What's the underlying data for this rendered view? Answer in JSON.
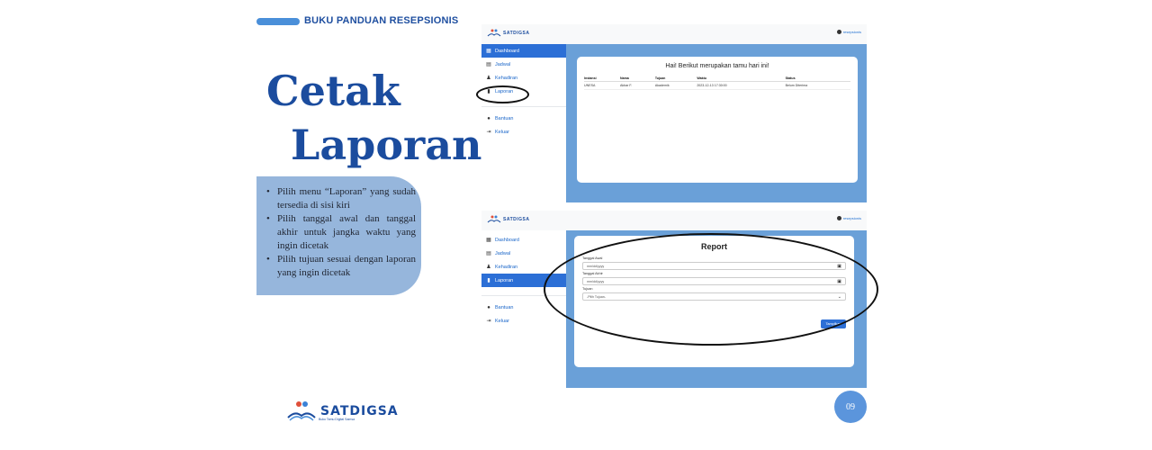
{
  "header": {
    "label": "BUKU PANDUAN RESEPSIONIS"
  },
  "title": {
    "line1": "Cetak",
    "line2": "Laporan"
  },
  "steps": [
    "Pilih menu “Laporan” yang sudah tersedia di sisi kiri",
    "Pilih tanggal awal dan tanggal akhir untuk jangka waktu yang ingin dicetak",
    "Pilih tujuan sesuai dengan laporan yang ingin dicetak"
  ],
  "brand": {
    "name": "SATDIGSA",
    "tagline": "Buku Tamu Digital Samsa"
  },
  "page_number": "09",
  "app": {
    "logo": "SATDIGSA",
    "user": "resepsionis",
    "nav": [
      "Dashboard",
      "Jadwal",
      "Kehadiran",
      "Laporan",
      "Bantuan",
      "Keluar"
    ]
  },
  "dashboard": {
    "greeting": "Hai! Berikut merupakan tamu hari ini!",
    "columns": [
      "Instansi",
      "Nama",
      "Tujuan",
      "Waktu",
      "Status"
    ],
    "rows": [
      [
        "UNESA",
        "Akbar F.",
        "Akademik",
        "2023-12-13 17:30:00",
        "Belum Diterima"
      ]
    ]
  },
  "report": {
    "title": "Report",
    "start_label": "Tanggal Awal",
    "start_placeholder": "mm/dd/yyyy",
    "end_label": "Tanggal Akhir",
    "end_placeholder": "mm/dd/yyyy",
    "purpose_label": "Tujuan",
    "purpose_placeholder": "-Pilih Tujuan-",
    "submit_label": "Tampilkan"
  },
  "colors": {
    "primary": "#2c6fd6",
    "title": "#1b4c9e",
    "panel": "#96b6dc",
    "status_pending": "#d9a81a"
  }
}
